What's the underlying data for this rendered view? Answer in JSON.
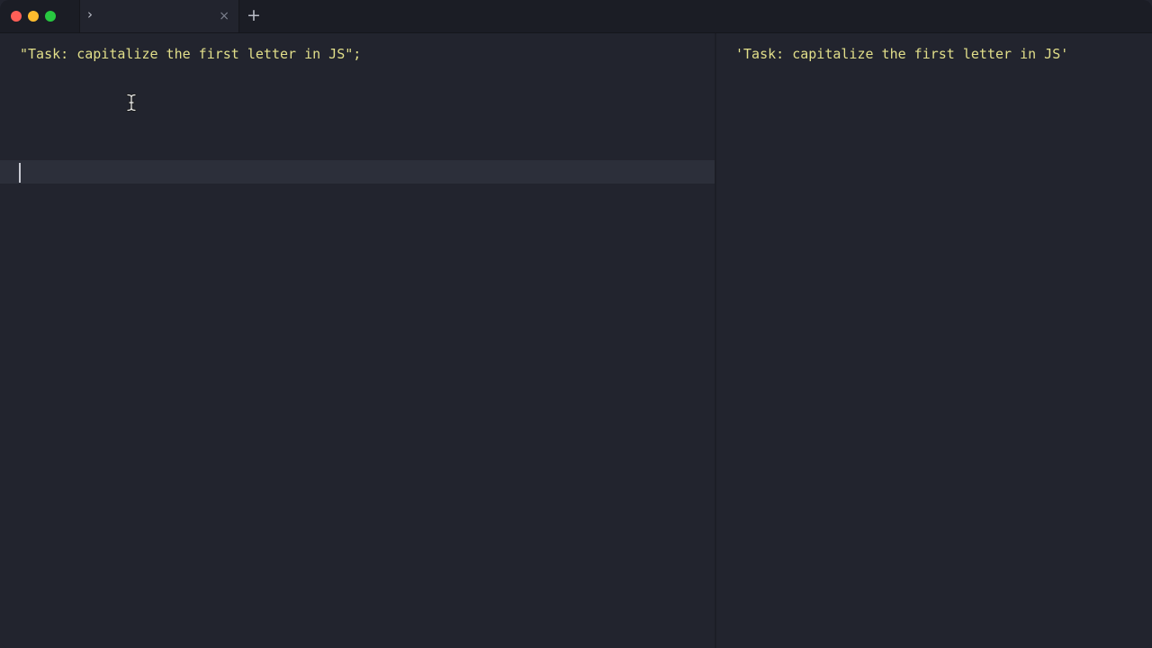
{
  "window": {
    "traffic_lights": {
      "close_color": "#ff5f57",
      "minimize_color": "#febc2e",
      "maximize_color": "#28c840"
    }
  },
  "tabs": {
    "active_tab": {
      "icon": "chevron-right-icon",
      "glyph": "›",
      "close_glyph": "×"
    },
    "new_tab_glyph": "+"
  },
  "editor": {
    "lines": [
      "\"Task: capitalize the first letter in JS\";"
    ],
    "cursor_line": 7,
    "text_color": "#e2df8a"
  },
  "output": {
    "lines": [
      "'Task: capitalize the first letter in JS'"
    ],
    "text_color": "#e2df8a"
  },
  "colors": {
    "background": "#22242e",
    "titlebar": "#1b1d25",
    "active_line": "#2c2f3a"
  }
}
